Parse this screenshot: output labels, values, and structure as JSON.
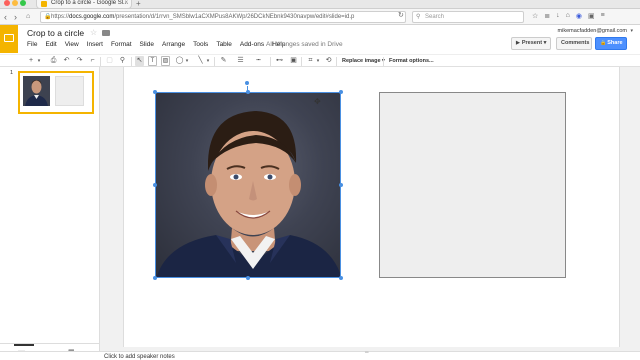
{
  "browser": {
    "tab_title": "Crop to a circle - Google Sl...",
    "url_host": "docs.google.com",
    "url_prefix": "https://",
    "url_path": "/presentation/d/1rrvn_SMSblw1aCXMPus8AKWp/26DCkNEbnk9430navpw/edit#slide=id.p",
    "search_placeholder": "Search"
  },
  "app": {
    "doc_title": "Crop to a circle",
    "account": "mikemacfadden@gmail.com",
    "present_label": "Present",
    "comments_label": "Comments",
    "share_label": "Share",
    "saved_status": "All changes saved in Drive"
  },
  "menu": [
    "File",
    "Edit",
    "View",
    "Insert",
    "Format",
    "Slide",
    "Arrange",
    "Tools",
    "Table",
    "Add-ons",
    "Help"
  ],
  "toolbar": {
    "replace_image_label": "Replace image",
    "format_options_label": "Format options..."
  },
  "filmstrip": {
    "slide_number": "1"
  },
  "notes": {
    "placeholder": "Click to add speaker notes"
  },
  "colors": {
    "accent_yellow": "#f4b400",
    "selection_blue": "#4a90e2",
    "share_blue": "#4d90fe"
  }
}
